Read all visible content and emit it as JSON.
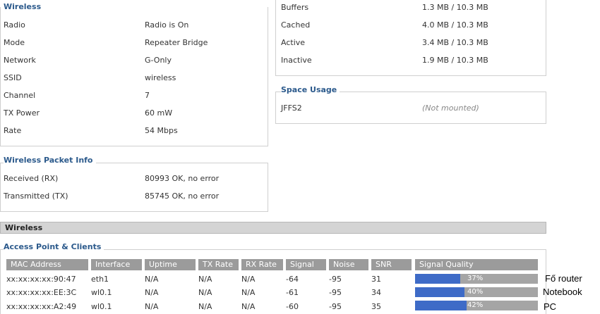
{
  "wireless": {
    "legend": "Wireless",
    "rows": [
      {
        "label": "Radio",
        "value": "Radio is On"
      },
      {
        "label": "Mode",
        "value": "Repeater Bridge"
      },
      {
        "label": "Network",
        "value": "G-Only"
      },
      {
        "label": "SSID",
        "value": "wireless"
      },
      {
        "label": "Channel",
        "value": "7"
      },
      {
        "label": "TX Power",
        "value": "60 mW"
      },
      {
        "label": "Rate",
        "value": "54 Mbps"
      }
    ]
  },
  "memory": {
    "rows": [
      {
        "label": "Buffers",
        "value": "1.3 MB / 10.3 MB"
      },
      {
        "label": "Cached",
        "value": "4.0 MB / 10.3 MB"
      },
      {
        "label": "Active",
        "value": "3.4 MB / 10.3 MB"
      },
      {
        "label": "Inactive",
        "value": "1.9 MB / 10.3 MB"
      }
    ]
  },
  "space_usage": {
    "legend": "Space Usage",
    "label": "JFFS2",
    "value": "(Not mounted)"
  },
  "packet_info": {
    "legend": "Wireless Packet Info",
    "rows": [
      {
        "label": "Received (RX)",
        "value": "80993 OK, no error"
      },
      {
        "label": "Transmitted (TX)",
        "value": "85745 OK, no error"
      }
    ]
  },
  "section_title": "Wireless",
  "ap_clients": {
    "legend": "Access Point & Clients",
    "headers": [
      "MAC Address",
      "Interface",
      "Uptime",
      "TX Rate",
      "RX Rate",
      "Signal",
      "Noise",
      "SNR",
      "Signal Quality"
    ],
    "rows": [
      {
        "mac": "xx:xx:xx:xx:90:47",
        "iface": "eth1",
        "uptime": "N/A",
        "tx": "N/A",
        "rx": "N/A",
        "signal": "-64",
        "noise": "-95",
        "snr": "31",
        "quality_text": "37%",
        "quality": 37
      },
      {
        "mac": "xx:xx:xx:xx:EE:3C",
        "iface": "wl0.1",
        "uptime": "N/A",
        "tx": "N/A",
        "rx": "N/A",
        "signal": "-61",
        "noise": "-95",
        "snr": "34",
        "quality_text": "40%",
        "quality": 40
      },
      {
        "mac": "xx:xx:xx:xx:A2:49",
        "iface": "wl0.1",
        "uptime": "N/A",
        "tx": "N/A",
        "rx": "N/A",
        "signal": "-60",
        "noise": "-95",
        "snr": "35",
        "quality_text": "42%",
        "quality": 42
      }
    ]
  },
  "side_notes": [
    "Fő router",
    "Notebook",
    "PC"
  ],
  "colors": {
    "legend": "#2c5a8c",
    "header_bg": "#9b9b9b",
    "bar_fill": "#3e6bc7",
    "bar_bg": "#a5a5a5"
  }
}
